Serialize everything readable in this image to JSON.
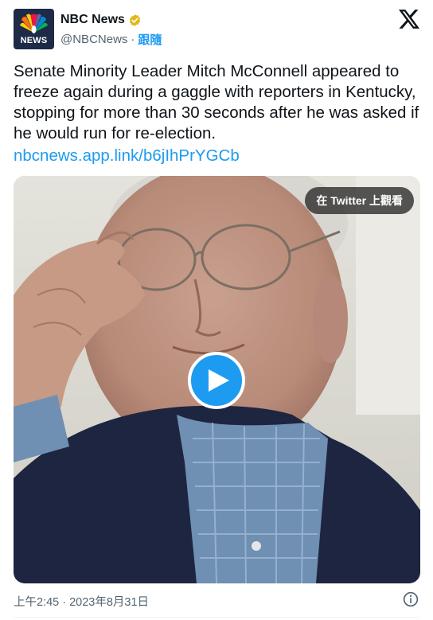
{
  "account": {
    "name": "NBC News",
    "handle": "@NBCNews",
    "separator": "·",
    "follow_label": "跟隨",
    "avatar_text": "NEWS"
  },
  "tweet": {
    "text": "Senate Minority Leader Mitch McConnell appeared to freeze again during a gaggle with reporters in Kentucky, stopping for more than 30 seconds after he was asked if he would run for re-election.",
    "link": "nbcnews.app.link/b6jIhPrYGCb"
  },
  "media": {
    "watch_on_twitter_label": "在 Twitter 上觀看",
    "type": "video"
  },
  "footer": {
    "timestamp": "上午2:45 · 2023年8月31日"
  },
  "icons": {
    "verified": "verified-badge-icon",
    "platform": "x-logo-icon",
    "play": "play-icon",
    "info": "info-icon"
  },
  "colors": {
    "link": "#1d9bf0",
    "verified_badge": "#e2b719",
    "play_button": "#1d9bf0",
    "secondary_text": "#536471"
  }
}
